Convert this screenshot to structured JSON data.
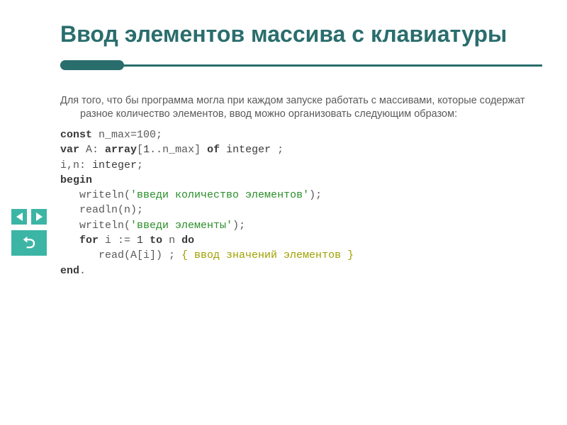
{
  "title": "Ввод элементов массива с клавиатуры",
  "intro": "Для того, что бы программа могла при каждом запуске работать с массивами, которые содержат разное количество элементов, ввод можно организовать следующим образом:",
  "code": {
    "l1_kw": "const",
    "l1_rest": " n_max=100;",
    "l2_kw1": "var",
    "l2_a": " A: ",
    "l2_kw2": "array",
    "l2_b": "[",
    "l2_num": "1",
    "l2_c": "..n_max] ",
    "l2_kw3": "of",
    "l2_d": " ",
    "l2_kw4": "integer",
    "l2_e": " ;",
    "l3_a": "i,n: ",
    "l3_kw": "integer",
    "l3_b": ";",
    "l4_kw": "begin",
    "l5_a": "   writeln(",
    "l5_str": "'введи количество элементов'",
    "l5_b": ");",
    "l6": "   readln(n);",
    "l7_a": "   writeln(",
    "l7_str": "'введи элементы'",
    "l7_b": ");",
    "l8_a": "   ",
    "l8_kw1": "for",
    "l8_b": " i := ",
    "l8_num": "1",
    "l8_c": " ",
    "l8_kw2": "to",
    "l8_d": " n ",
    "l8_kw3": "do",
    "l9_a": "      read(A[i]) ; ",
    "l9_comment": "{ ввод значений элементов }",
    "l10_kw": "end",
    "l10_b": "."
  },
  "nav": {
    "prev": "prev",
    "next": "next",
    "up": "up"
  }
}
